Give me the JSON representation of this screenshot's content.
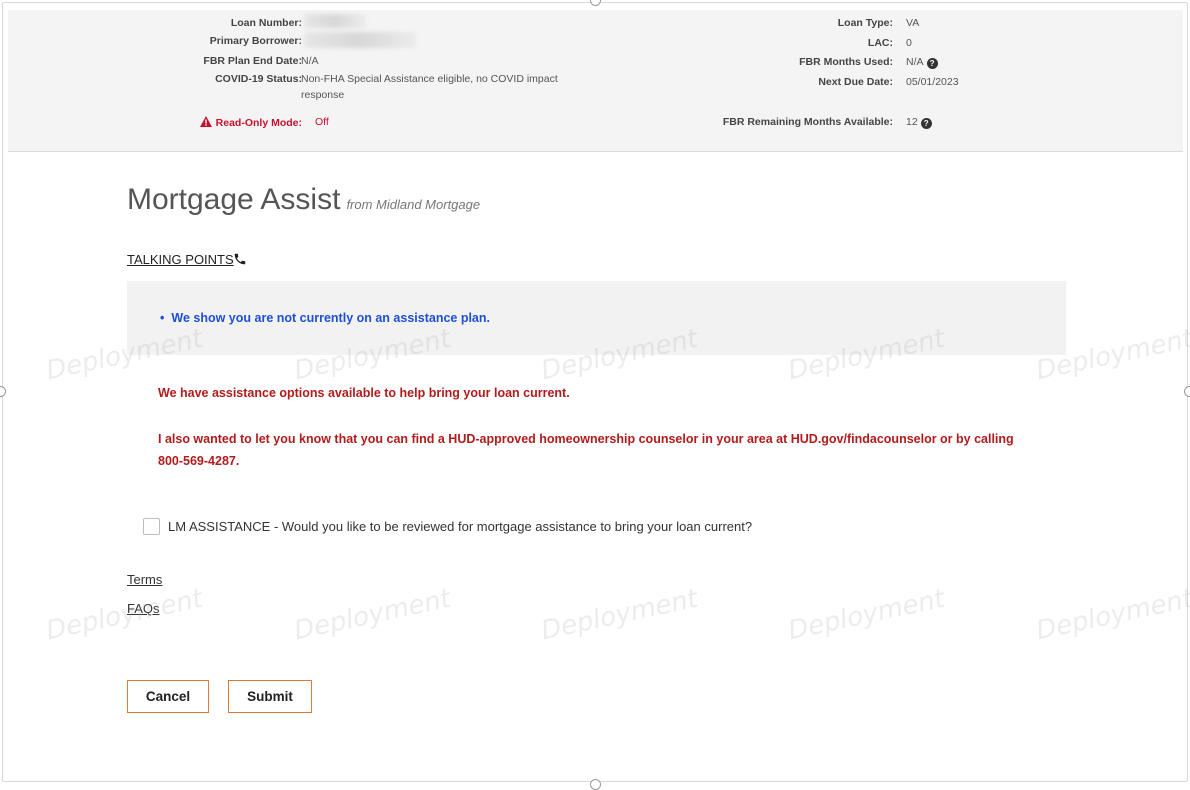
{
  "info": {
    "left": [
      {
        "label": "Loan Number:",
        "value": ""
      },
      {
        "label": "Primary Borrower:",
        "value": ""
      },
      {
        "label": "FBR Plan End Date:",
        "value": "N/A"
      },
      {
        "label": "COVID-19 Status:",
        "value": "Non-FHA Special Assistance eligible, no COVID impact response"
      },
      {
        "label": "Read-Only Mode:",
        "value": "Off"
      }
    ],
    "right": [
      {
        "label": "Loan Type:",
        "value": "VA"
      },
      {
        "label": "LAC:",
        "value": "0"
      },
      {
        "label": "FBR Months Used:",
        "value": "N/A"
      },
      {
        "label": "Next Due Date:",
        "value": "05/01/2023"
      },
      {
        "label": "FBR Remaining Months Available:",
        "value": "12"
      }
    ]
  },
  "page": {
    "title": "Mortgage Assist",
    "subtitle": "from Midland Mortgage"
  },
  "talking_points": {
    "label": "TALKING POINTS",
    "bullet": "We show you are not currently on an assistance plan."
  },
  "messages": {
    "line1": "We have assistance options available to help bring your loan current.",
    "line2": "I also wanted to let you know that you can find a HUD-approved homeownership counselor in your area at HUD.gov/findacounselor or by calling 800-569-4287."
  },
  "checkbox": {
    "label": "LM ASSISTANCE - Would you like to be reviewed for mortgage assistance to bring your loan current?",
    "checked": false
  },
  "links": {
    "terms": "Terms",
    "faqs": "FAQs"
  },
  "buttons": {
    "cancel": "Cancel",
    "submit": "Submit"
  },
  "watermark": "Deployment",
  "colors": {
    "accent_border": "#e07a2f",
    "alert_red": "#b31b1b",
    "bullet_blue": "#1d4fd8"
  }
}
